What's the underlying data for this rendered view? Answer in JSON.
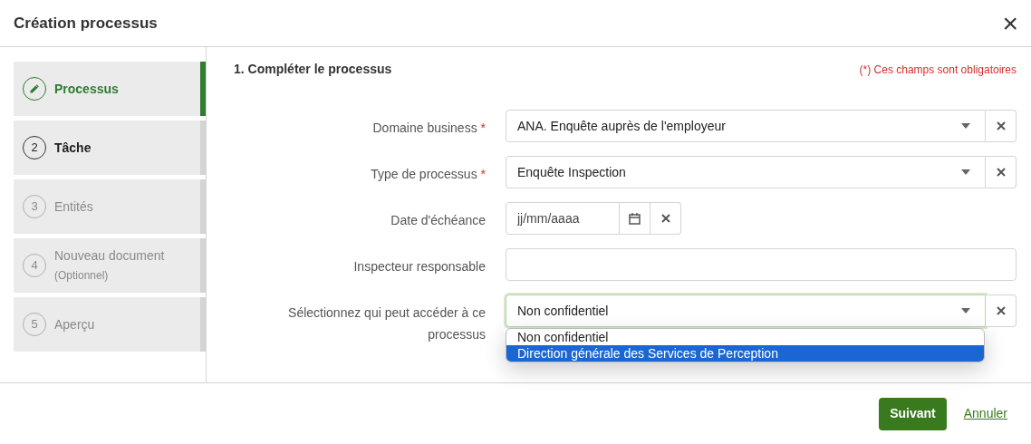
{
  "window": {
    "title": "Création processus",
    "close": "×"
  },
  "steps": [
    {
      "label": "Processus",
      "selected": true,
      "disabled": false
    },
    {
      "number": "2",
      "label": "Tâche",
      "selected": false,
      "disabled": false
    },
    {
      "number": "3",
      "label": "Entités",
      "selected": false,
      "disabled": true
    },
    {
      "number": "4",
      "label": "Nouveau document",
      "note": "(Optionnel)",
      "selected": false,
      "disabled": true
    },
    {
      "number": "5",
      "label": "Aperçu",
      "selected": false,
      "disabled": true
    }
  ],
  "form": {
    "heading": "1. Compléter le processus",
    "required_note": "(*) Ces champs sont obligatoires",
    "fields": [
      {
        "kind": "select",
        "label": "Domaine business",
        "required_mark": "*",
        "value": "ANA. Enquête auprès de l'employeur"
      },
      {
        "kind": "select",
        "label": "Type de processus",
        "required_mark": "*",
        "value": "Enquête Inspection"
      },
      {
        "kind": "date",
        "label": "Date d'échéance",
        "placeholder": "jj/mm/aaaa"
      },
      {
        "kind": "text",
        "label": "Inspecteur responsable"
      },
      {
        "kind": "select",
        "label": "Sélectionnez qui peut accéder à ce processus",
        "value": "Non confidentiel",
        "focused": true,
        "options": [
          {
            "label": "Non confidentiel",
            "highlighted": false
          },
          {
            "label": "Direction générale des Services de Perception",
            "highlighted": true
          }
        ]
      }
    ]
  },
  "footer": {
    "buttons": [
      "Suivant",
      "Annuler"
    ]
  }
}
